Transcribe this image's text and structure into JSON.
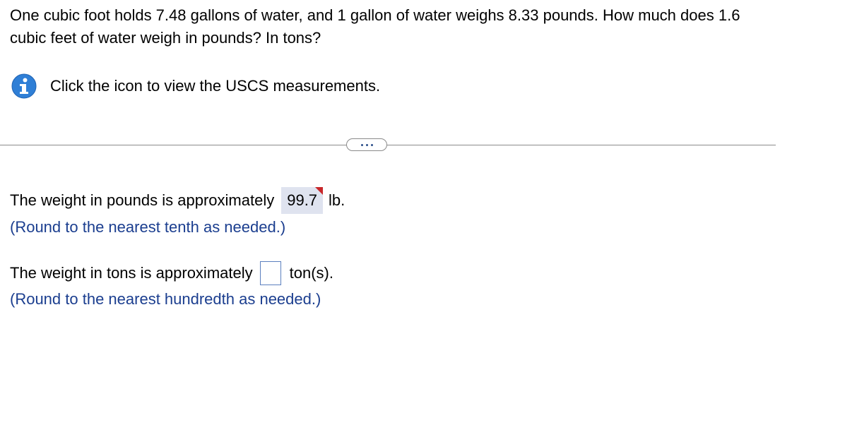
{
  "question": {
    "text": "One cubic foot holds 7.48 gallons of water, and 1 gallon of water weighs 8.33 pounds. How much does 1.6 cubic feet of water weigh in pounds? In tons?"
  },
  "info": {
    "icon": "info-icon",
    "text": "Click the icon to view the USCS measurements."
  },
  "expand_button": {
    "icon": "ellipsis-icon"
  },
  "answer_pounds": {
    "prefix": "The weight in pounds is approximately",
    "value": "99.7",
    "unit": "lb.",
    "hint": "(Round to the nearest tenth as needed.)"
  },
  "answer_tons": {
    "prefix": "The weight in tons is approximately",
    "value": "",
    "unit": "ton(s).",
    "hint": "(Round to the nearest hundredth as needed.)"
  },
  "colors": {
    "hint_text": "#1b3e8f",
    "info_icon": "#2f7fd6",
    "filled_answer_bg": "#dfe3ef",
    "incorrect_marker": "#c8272a",
    "input_border": "#5b7fbf"
  }
}
